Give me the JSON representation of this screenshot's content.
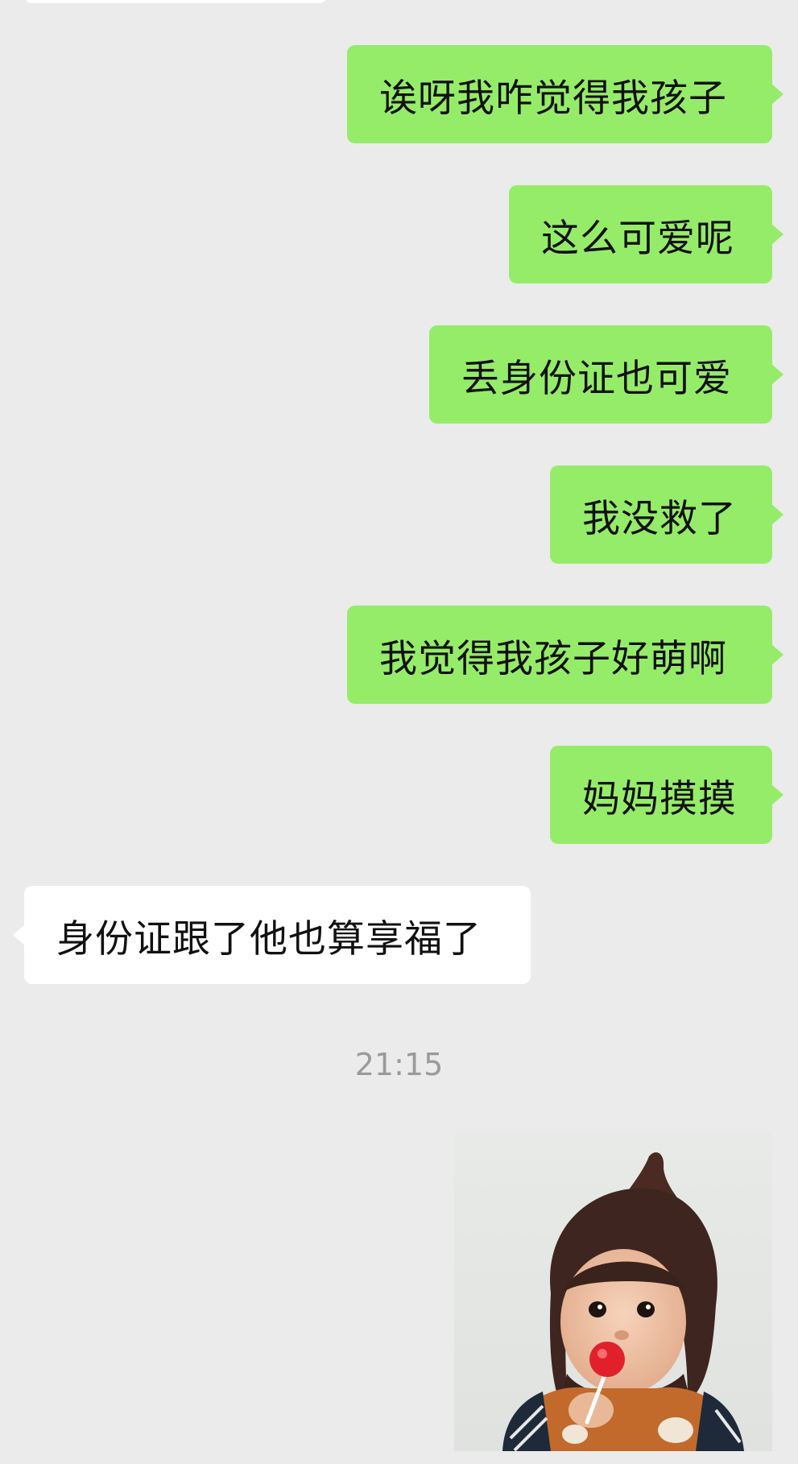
{
  "messages": [
    {
      "side": "mine",
      "text": "诶呀我咋觉得我孩子"
    },
    {
      "side": "mine",
      "text": "这么可爱呢"
    },
    {
      "side": "mine",
      "text": "丢身份证也可爱"
    },
    {
      "side": "mine",
      "text": "我没救了"
    },
    {
      "side": "mine",
      "text": "我觉得我孩子好萌啊"
    },
    {
      "side": "mine",
      "text": "妈妈摸摸"
    },
    {
      "side": "theirs",
      "text": "身份证跟了他也算享福了"
    }
  ],
  "timestamp": "21:15",
  "image_message": {
    "icon": "child-with-lollipop-photo"
  },
  "colors": {
    "background": "#ebebeb",
    "my_bubble": "#95ec69",
    "their_bubble": "#ffffff",
    "timestamp_text": "#9a9a9a"
  }
}
